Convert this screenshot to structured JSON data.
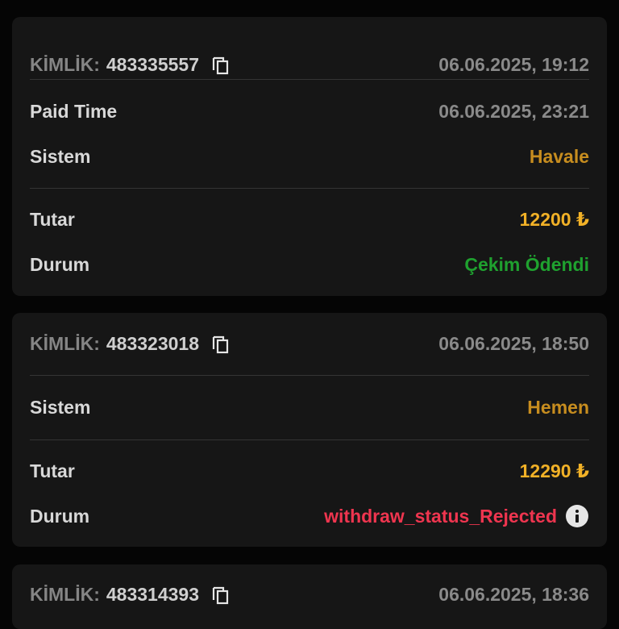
{
  "common": {
    "id_prefix": "KİMLİK:",
    "icons": {
      "copy": "copy-icon",
      "info": "info-icon"
    }
  },
  "colors": {
    "background": "#050505",
    "card": "#161616",
    "label": "#d8d8d8",
    "muted": "#8a8a8a",
    "system": "#c78d1f",
    "amount": "#f1b127",
    "paid": "#1fa12f",
    "rejected": "#ef354f"
  },
  "cards": [
    {
      "id": "483335557",
      "date": "06.06.2025, 19:12",
      "paid_time_label": "Paid Time",
      "paid_time": "06.06.2025, 23:21",
      "system_label": "Sistem",
      "system": "Havale",
      "amount_label": "Tutar",
      "amount": "12200 ₺",
      "status_label": "Durum",
      "status": "Çekim Ödendi"
    },
    {
      "id": "483323018",
      "date": "06.06.2025, 18:50",
      "system_label": "Sistem",
      "system": "Hemen",
      "amount_label": "Tutar",
      "amount": "12290 ₺",
      "status_label": "Durum",
      "status": "withdraw_status_Rejected"
    },
    {
      "id": "483314393",
      "date": "06.06.2025, 18:36"
    }
  ]
}
